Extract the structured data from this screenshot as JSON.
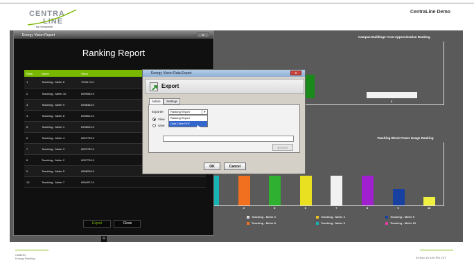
{
  "header": {
    "logo_text": "CENTRALINE",
    "logo_sub": "by Honeywell",
    "app_name": "CentraLine Demo"
  },
  "charts": {
    "cost_title": "Campus Buildings' Cost Approximation Ranking",
    "cost_tick": "3",
    "power_title": "Teaching Block Power Usage Ranking",
    "colors": [
      "#17b3b3",
      "#f07020",
      "#30b030",
      "#e8e020",
      "#f2f2f2",
      "#a020d0",
      "#1840a0",
      "#f0f040"
    ],
    "chart_data": {
      "type": "bar",
      "title": "Teaching Block Power Usage Ranking",
      "categories": [
        "3",
        "4",
        "5",
        "6",
        "7",
        "8",
        "9",
        "10"
      ],
      "values": [
        7,
        7,
        7,
        7,
        7,
        7,
        4,
        2
      ],
      "visible_tick_labels": [
        "4",
        "5",
        "6",
        "7",
        "8",
        "9",
        "10"
      ]
    },
    "legend": [
      {
        "label": "Teaching - Meter 2",
        "color": "#dddddd"
      },
      {
        "label": "Teaching - Meter 3",
        "color": "#dddddd"
      },
      {
        "label": "Teaching - Meter 4",
        "color": "#f0c020"
      },
      {
        "label": "Teaching - Meter 5",
        "color": "#1840a0"
      },
      {
        "label": "Teaching - Meter 7",
        "color": "#dddddd"
      },
      {
        "label": "Teaching - Meter 8",
        "color": "#f07020"
      },
      {
        "label": "Teaching - Meter 9",
        "color": "#17b3b3"
      },
      {
        "label": "Teaching - Meter 10",
        "color": "#e040a0"
      }
    ]
  },
  "footer": {
    "left_line1": "CABINS",
    "left_line2": "Energy Ranking",
    "right": "09-Nov-16 5:00 PM CST"
  },
  "ranking": {
    "window_title": "Energy Vision Report",
    "close_x": "x",
    "heading": "Ranking Report",
    "columns": [
      "Rank",
      "Name",
      "Value"
    ],
    "rows": [
      [
        "1",
        "Teaching - Meter 6",
        "7001174.0"
      ],
      [
        "2",
        "Teaching - Meter 10",
        "6999554.0"
      ],
      [
        "3",
        "Teaching - Meter 9",
        "6998463.0"
      ],
      [
        "4",
        "Teaching - Meter 8",
        "6998513.0"
      ],
      [
        "5",
        "Teaching - Meter 1",
        "6998022.0"
      ],
      [
        "6",
        "Teaching - Meter 4",
        "6997759.0"
      ],
      [
        "7",
        "Teaching - Meter 3",
        "6997782.0"
      ],
      [
        "8",
        "Teaching - Meter 2",
        "6997745.0"
      ],
      [
        "9",
        "Teaching - Meter 5",
        "6996009.0"
      ],
      [
        "10",
        "Teaching - Meter 7",
        "6994971.0"
      ]
    ],
    "export_label": "Export",
    "close_label": "Close",
    "stray_label": "R"
  },
  "export": {
    "window_title": "Energy Vision Data Export",
    "close_x": "x",
    "heading": "Export",
    "tabs": [
      "Action",
      "Settings"
    ],
    "exporter_label": "Exporter",
    "exporter_value": "Ranking Report",
    "exporter_options": [
      "Ranking Report",
      "Data Table PDF"
    ],
    "view_label": "View",
    "save_label": "save",
    "browse_label": "Browse",
    "ok_label": "OK",
    "cancel_label": "Cancel"
  }
}
